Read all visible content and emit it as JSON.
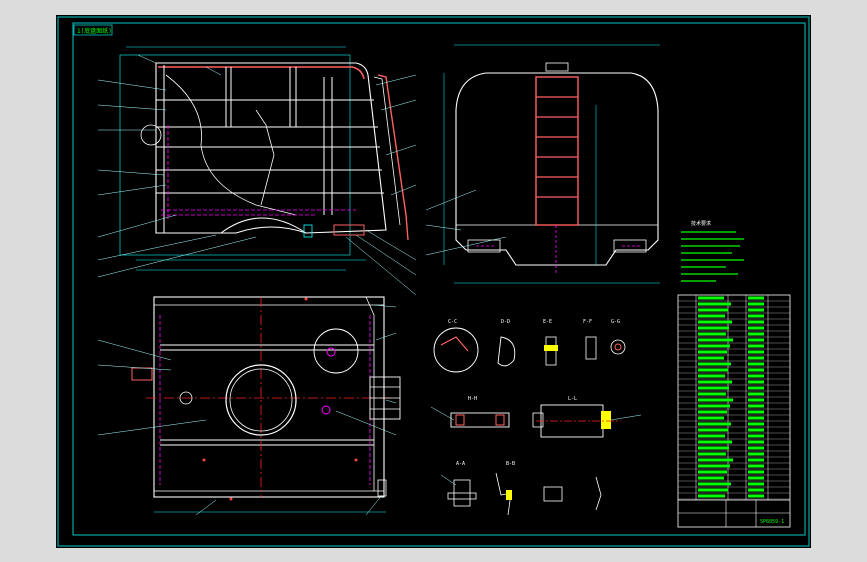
{
  "drawing": {
    "corner_tag": "1(底盘图纸)",
    "title_code": "SP6059-1",
    "spec_title": "技术要求",
    "section_tags": [
      "C-C",
      "D-D",
      "E-E",
      "F-F",
      "G-G",
      "H-H",
      "L-L",
      "A-A",
      "B-B"
    ],
    "colors": {
      "background": "#000000",
      "frame": "#00c8c8",
      "outline": "#ffffff",
      "hidden": "#ff00ff",
      "center": "#ff2020",
      "dimension": "#00ffff",
      "table": "#00ff00",
      "leader": "#a0ffff"
    }
  }
}
